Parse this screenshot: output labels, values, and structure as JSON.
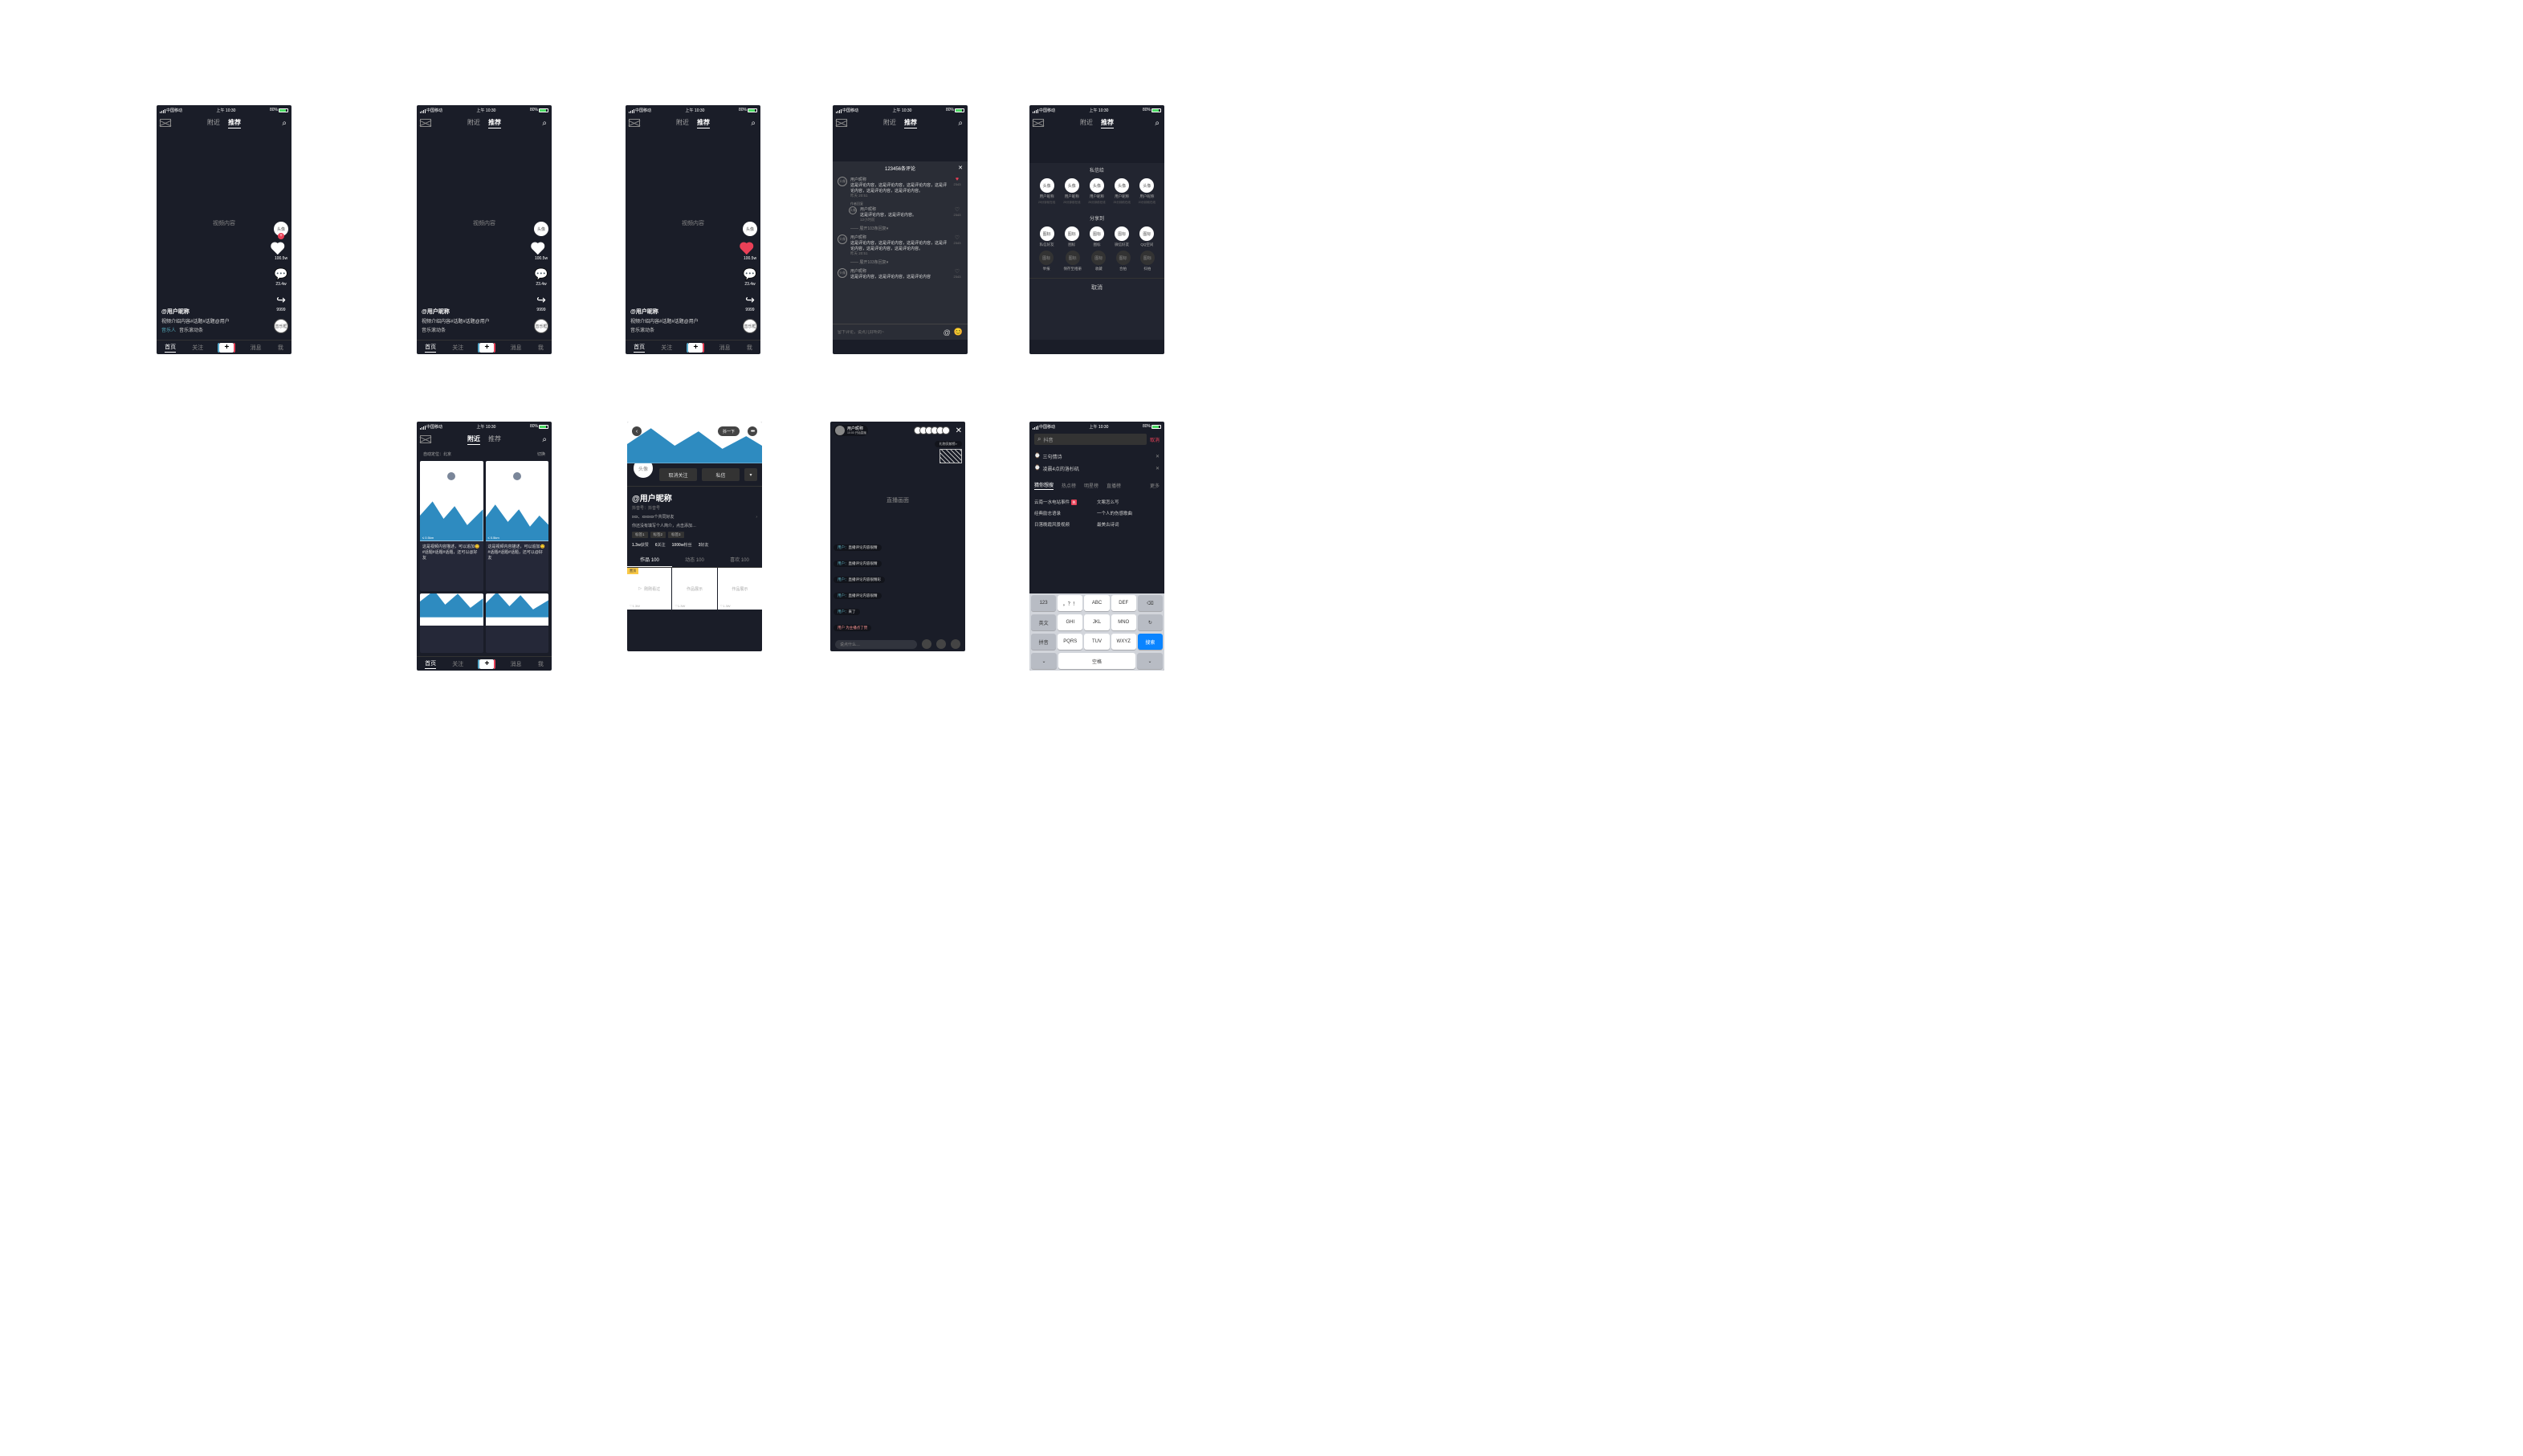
{
  "status": {
    "carrier": "中国移动",
    "time": "上午 10:30",
    "battery": "80%"
  },
  "nav": {
    "nearby": "附近",
    "recommend": "推荐"
  },
  "bottom": {
    "home": "首页",
    "follow": "关注",
    "msg": "消息",
    "me": "我"
  },
  "feed": {
    "vidlabel": "视频内容",
    "avatar": "头像",
    "like": "100.5w",
    "comment": "23.4w",
    "share": "9999",
    "disc": "音乐框",
    "caption_user": "@用户昵称",
    "caption_desc": "视频介绍内容#话题#话题@用户",
    "caption_tag": "音乐人",
    "caption_track": "音乐滚动条"
  },
  "comments": {
    "header": "123456条评论",
    "placeholder": "留下评论，说点儿好听的~",
    "items": [
      {
        "name": "用户昵称",
        "text": "这是评论内容，这是评论内容，这是评论内容，这是评论内容，这是评论内容，这是评论内容。",
        "time": "昨天 20:51",
        "likes": "2343",
        "liked": true
      },
      {
        "isReply": true,
        "name": "用户昵称",
        "text": "这是评论内容，这是评论内容。",
        "time": "12小时前",
        "expand": "—— 展开103条回复▾"
      },
      {
        "name": "用户昵称",
        "text": "这是评论内容，这是评论内容，这是评论内容，这是评论内容，这是评论内容，这是评论内容。",
        "time": "昨天 20:51",
        "likes": "2343",
        "expand": "—— 展开103条回复▾"
      },
      {
        "name": "用户昵称",
        "text": "这是评论内容，这是评论内容，这是评论内容",
        "time": "",
        "likes": "2343"
      }
    ],
    "author_badge": "作者回复"
  },
  "share": {
    "t1": "私信给",
    "t2": "分享到",
    "friends": [
      {
        "l": "用户昵称",
        "s": "25分钟前在线"
      },
      {
        "l": "用户昵称",
        "s": "25分钟前在线"
      },
      {
        "l": "用户昵称",
        "s": "25分钟前在线"
      },
      {
        "l": "用户昵称",
        "s": "25分钟前在线"
      },
      {
        "l": "用户昵称",
        "s": "20分钟前在线"
      }
    ],
    "row1": [
      "私信好友",
      "图标",
      "图标",
      "微信好友",
      "QQ空间"
    ],
    "row2": [
      "举报",
      "保存至相册",
      "收藏",
      "合拍",
      "抖拍"
    ],
    "cancel": "取消"
  },
  "nearby": {
    "loc": "自动定位：北京",
    "switch": "切换",
    "desc": "这是视频内容描述，可以追加😊#话题#话题#话题，还可以@好友",
    "dist": "≤ 0.5km"
  },
  "profile": {
    "shake": "抖一下",
    "avatar": "头像",
    "unfollow": "取消关注",
    "dm": "私信",
    "name": "@用户昵称",
    "id": "抖音号：抖音号",
    "friends": "xxx、xxxxxx个共同好友",
    "bio": "你还没有填写个人简介，点击添加…",
    "tags": [
      "标签1",
      "标签2",
      "标签3"
    ],
    "stats": [
      {
        "n": "1.3w",
        "l": "获赞"
      },
      {
        "n": "6",
        "l": "关注"
      },
      {
        "n": "1000w",
        "l": "粉丝"
      },
      {
        "n": "3",
        "l": "好友"
      }
    ],
    "tabs": [
      "作品 100",
      "动态 100",
      "喜欢 100"
    ],
    "cells": [
      "刚刚看过",
      "作品展示",
      "作品展示"
    ],
    "pin": "置顶",
    "viewcount": "1.3W"
  },
  "live": {
    "host": "用户昵称",
    "hsub": "10:00 开始直播",
    "gifts": "礼物贡献榜>",
    "label": "直播画面",
    "msgs": [
      {
        "u": "用户：",
        "t": "直播评论内容很精"
      },
      {
        "u": "用户：",
        "t": "直播评论内容很精"
      },
      {
        "u": "用户：",
        "t": "直播评论内容很精彩"
      },
      {
        "u": "用户：",
        "t": "直播评论内容很精"
      },
      {
        "u": "用户：",
        "t": "来了"
      },
      {
        "sys": true,
        "t": "用户 为主播点了赞"
      }
    ],
    "placeholder": "说点什么…"
  },
  "search": {
    "query": "抖音",
    "cancel": "取消",
    "history": [
      "三句情诗",
      "凌晨4点的洛杉矶"
    ],
    "tabs": [
      "猜你想搜",
      "热点榜",
      "明星榜",
      "直播榜"
    ],
    "tabs_more": "更多",
    "suggestions": [
      [
        "云南一水电站事件",
        "文案怎么写"
      ],
      [
        "经典励志语录",
        "一个人的伤感歌曲"
      ],
      [
        "日落晚霞风景视频",
        "最美古诗词"
      ]
    ],
    "hot_badge": "热",
    "keyboard": {
      "r1": [
        "123",
        "。？！",
        "ABC",
        "DEF",
        "⌫"
      ],
      "r2": [
        "英文",
        "GHI",
        "JKL",
        "MNO",
        "↻"
      ],
      "r3": [
        "拼音",
        "PQRS",
        "TUV",
        "WXYZ",
        "搜索"
      ],
      "r4": [
        "⌄",
        "空格",
        "⌄"
      ]
    }
  },
  "icon_glyph": "图标"
}
